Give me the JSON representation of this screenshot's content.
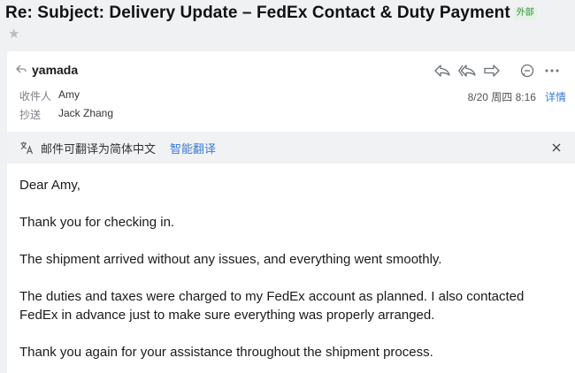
{
  "email": {
    "subject": "Re: Subject: Delivery Update – FedEx Contact & Duty Payment",
    "external_badge": "外部",
    "sender": "yamada",
    "to_label": "收件人",
    "to_value": "Amy",
    "cc_label": "抄送",
    "cc_value": "Jack Zhang",
    "date": "8/20 周四 8:16",
    "details_label": "详情"
  },
  "translate": {
    "prompt": "邮件可翻译为简体中文",
    "action": "智能翻译"
  },
  "body": {
    "p1": "Dear Amy,",
    "p2": "Thank you for checking in.",
    "p3": "The shipment arrived without any issues, and everything went smoothly.",
    "p4": "The duties and taxes were charged to my FedEx account as planned. I also contacted FedEx in advance just to make sure everything was properly arranged.",
    "p5": "Thank you again for your assistance throughout the shipment process."
  },
  "icons": {
    "star": "star-icon",
    "reply": "reply-icon",
    "reply_all": "reply-all-icon",
    "forward": "forward-icon",
    "chat": "chat-icon",
    "more": "more-icon",
    "translate": "translate-icon",
    "close": "close-icon"
  },
  "colors": {
    "link": "#3a7bd5",
    "external_badge": "#2f8f3a",
    "icon": "#6b7078"
  }
}
